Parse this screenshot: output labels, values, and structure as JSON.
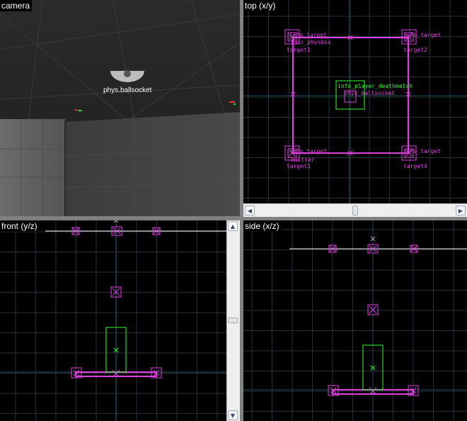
{
  "viewports": {
    "camera": {
      "title": "camera",
      "entity_label": "phys.ballsocket"
    },
    "top": {
      "title": "top (x/y)"
    },
    "front": {
      "title": "front (y/z)"
    },
    "side": {
      "title": "side (x/z)"
    }
  },
  "entities": {
    "target1": "info_target",
    "physbox": "func_physbox",
    "target1_name": "target1",
    "target2": "info_target",
    "target2_name": "target2",
    "deathmatch": "info_player_deathmatch",
    "ballsocket": "phys_ballsocket",
    "target3": "info_target",
    "emitter": "emitter",
    "target3_name": "target3",
    "target4": "info_target",
    "target4_name": "target4"
  },
  "colors": {
    "entity": "#e040e0",
    "brush": "#30ff30",
    "grid": "#2a3138",
    "axis": "#1f4c5c"
  },
  "scrollbar_icons": {
    "left": "arrow-left-icon",
    "right": "arrow-right-icon",
    "up": "arrow-up-icon",
    "down": "arrow-down-icon"
  }
}
